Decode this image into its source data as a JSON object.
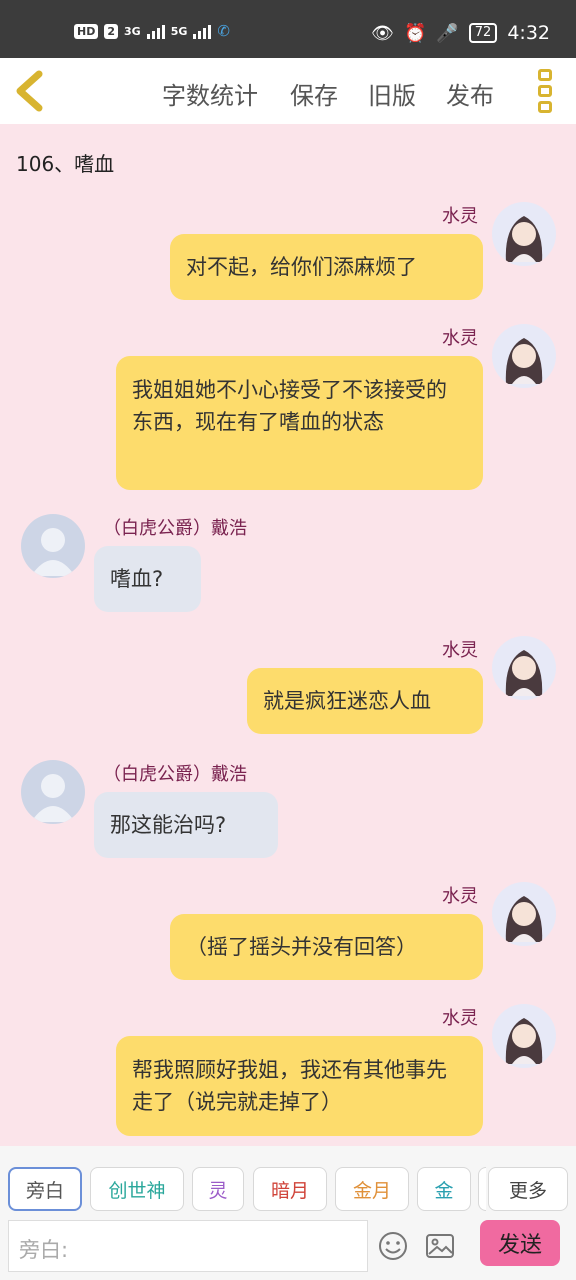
{
  "status_bar": {
    "hd": "HD",
    "sim": "2",
    "net1": "3G",
    "net2": "5G",
    "battery": "72",
    "time": "4:32"
  },
  "header": {
    "word_count": "字数统计",
    "save": "保存",
    "old_version": "旧版",
    "publish": "发布"
  },
  "chapter_title": "106、嗜血",
  "messages": [
    {
      "side": "right",
      "name": "水灵",
      "text": "对不起，给你们添麻烦了"
    },
    {
      "side": "right",
      "name": "水灵",
      "text": "我姐姐她不小心接受了不该接受的东西，现在有了嗜血的状态"
    },
    {
      "side": "left",
      "name": "（白虎公爵）戴浩",
      "text": "嗜血?"
    },
    {
      "side": "right",
      "name": "水灵",
      "text": "就是疯狂迷恋人血"
    },
    {
      "side": "left",
      "name": "（白虎公爵）戴浩",
      "text": "那这能治吗?"
    },
    {
      "side": "right",
      "name": "水灵",
      "text": "（摇了摇头并没有回答）"
    },
    {
      "side": "right",
      "name": "水灵",
      "text": "帮我照顾好我姐，我还有其他事先走了（说完就走掉了）"
    }
  ],
  "role_tabs": [
    {
      "label": "旁白",
      "color": "#555555"
    },
    {
      "label": "创世神",
      "color": "#2aa79b"
    },
    {
      "label": "灵",
      "color": "#9b5cc8"
    },
    {
      "label": "暗月",
      "color": "#d0443a"
    },
    {
      "label": "金月",
      "color": "#e0913a"
    },
    {
      "label": "金",
      "color": "#2aa0b0"
    }
  ],
  "more_label": "更多",
  "input_placeholder": "旁白:",
  "send_label": "发送",
  "colors": {
    "background": "#fbe4ea",
    "right_bubble": "#fddc6c",
    "left_bubble": "#e2e6ef",
    "name": "#7a2350",
    "send": "#f06aa0"
  }
}
